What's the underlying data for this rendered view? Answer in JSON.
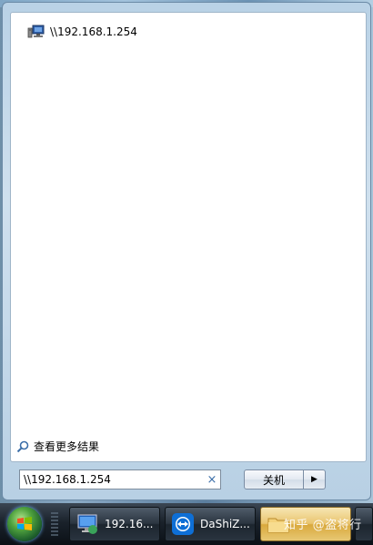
{
  "results": {
    "items": [
      {
        "label": "\\\\192.168.1.254",
        "icon": "network-computer-icon"
      }
    ],
    "see_more_label": "查看更多结果"
  },
  "search": {
    "value": "\\\\192.168.1.254",
    "clear_glyph": "×"
  },
  "shutdown": {
    "label": "关机",
    "arrow_glyph": "▶"
  },
  "taskbar": {
    "buttons": [
      {
        "label": "192.16...",
        "icon": "remote-desktop-icon"
      },
      {
        "label": "DaShiZ...",
        "icon": "teamviewer-icon"
      },
      {
        "label": "",
        "icon": "folder-icon"
      }
    ],
    "watermark": "知乎 @盗将行"
  },
  "colors": {
    "taskbar": "#1a222b",
    "accent": "#3b6ea8",
    "active_task": "#e9c56f"
  }
}
